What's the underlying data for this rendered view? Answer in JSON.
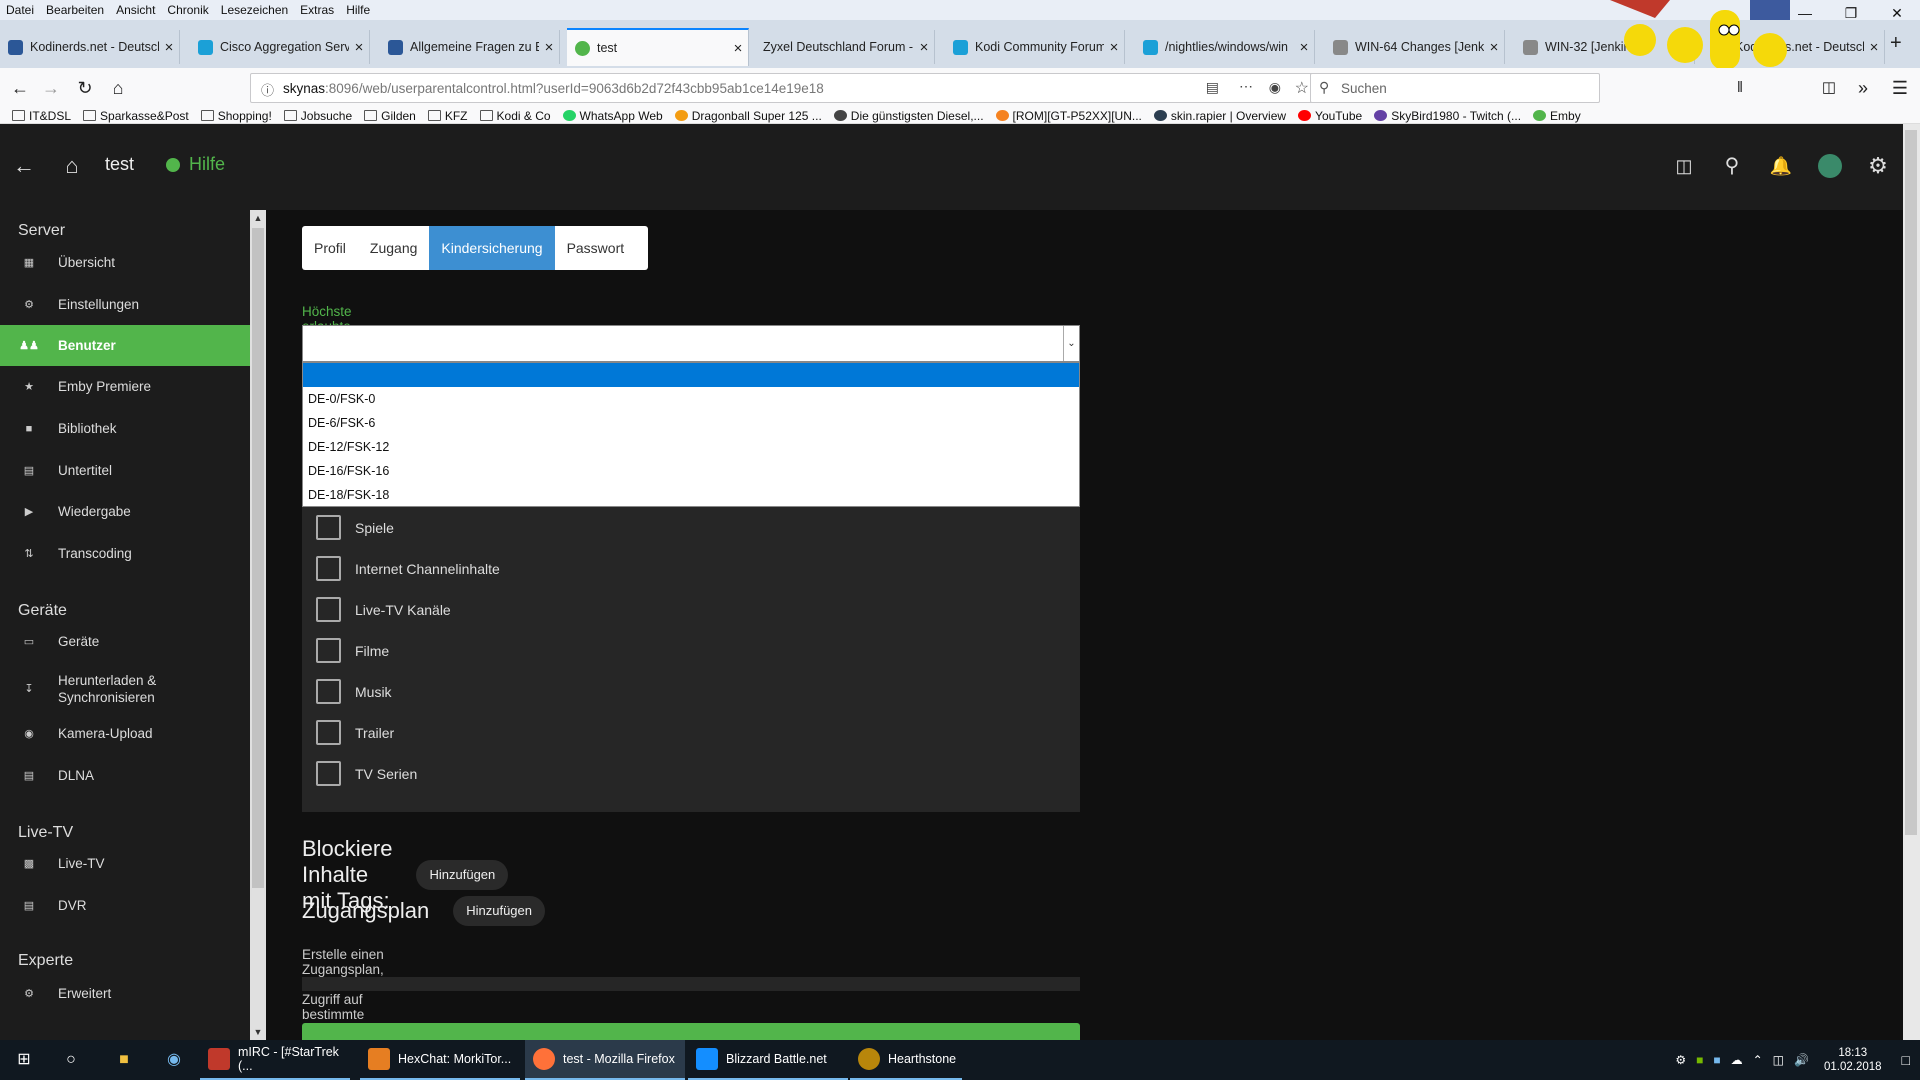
{
  "browser": {
    "menu": [
      "Datei",
      "Bearbeiten",
      "Ansicht",
      "Chronik",
      "Lesezeichen",
      "Extras",
      "Hilfe"
    ],
    "tabs": [
      {
        "label": "Kodinerds.net - Deutsch",
        "color": "#2b5797"
      },
      {
        "label": "Cisco Aggregation Servi",
        "color": "#1ba0d7"
      },
      {
        "label": "Allgemeine Fragen zu E",
        "color": "#2b5797"
      },
      {
        "label": "test",
        "color": "#52b54b"
      },
      {
        "label": "Zyxel Deutschland Forum - ",
        "color": "#ffffff"
      },
      {
        "label": "Kodi Community Forum",
        "color": "#1ba0d7"
      },
      {
        "label": "/nightlies/windows/win",
        "color": "#1ba0d7"
      },
      {
        "label": "WIN-64 Changes [Jenkin",
        "color": "#888888"
      },
      {
        "label": "WIN-32 [Jenkins]",
        "color": "#888888"
      },
      {
        "label": "Kodinerds.net - Deutsch",
        "color": "#2b5797"
      }
    ],
    "active_tab_index": 3,
    "url_host": "skynas",
    "url_path": ":8096/web/userparentalcontrol.html?userId=9063d6b2d72f43cbb95ab1ce14e19e18",
    "search_placeholder": "Suchen",
    "bookmarks": [
      {
        "label": "IT&DSL",
        "type": "folder"
      },
      {
        "label": "Sparkasse&Post",
        "type": "folder"
      },
      {
        "label": "Shopping!",
        "type": "folder"
      },
      {
        "label": "Jobsuche",
        "type": "folder"
      },
      {
        "label": "Gilden",
        "type": "folder"
      },
      {
        "label": "KFZ",
        "type": "folder"
      },
      {
        "label": "Kodi & Co",
        "type": "folder"
      },
      {
        "label": "WhatsApp Web",
        "type": "site",
        "color": "#25d366"
      },
      {
        "label": "Dragonball Super 125 ...",
        "type": "site",
        "color": "#f39c12"
      },
      {
        "label": "Die günstigsten Diesel,...",
        "type": "site",
        "color": "#444444"
      },
      {
        "label": "[ROM][GT-P52XX][UN...",
        "type": "site",
        "color": "#f58220"
      },
      {
        "label": "skin.rapier | Overview",
        "type": "site",
        "color": "#2c3e50"
      },
      {
        "label": "YouTube",
        "type": "site",
        "color": "#ff0000"
      },
      {
        "label": "SkyBird1980 - Twitch (...",
        "type": "site",
        "color": "#6441a5"
      },
      {
        "label": "Emby",
        "type": "site",
        "color": "#52b54b"
      }
    ]
  },
  "header": {
    "title": "test",
    "help_label": "Hilfe"
  },
  "sidebar": {
    "sections": [
      {
        "title": "Server",
        "items": [
          {
            "label": "Übersicht",
            "icon": "dashboard-icon"
          },
          {
            "label": "Einstellungen",
            "icon": "gear-icon"
          },
          {
            "label": "Benutzer",
            "icon": "people-icon",
            "active": true
          },
          {
            "label": "Emby Premiere",
            "icon": "star-icon"
          },
          {
            "label": "Bibliothek",
            "icon": "folder-icon"
          },
          {
            "label": "Untertitel",
            "icon": "subtitles-icon"
          },
          {
            "label": "Wiedergabe",
            "icon": "play-circle-icon"
          },
          {
            "label": "Transcoding",
            "icon": "transcode-icon"
          }
        ]
      },
      {
        "title": "Geräte",
        "items": [
          {
            "label": "Geräte",
            "icon": "devices-icon"
          },
          {
            "label": "Herunterladen & Synchronisieren",
            "icon": "download-icon"
          },
          {
            "label": "Kamera-Upload",
            "icon": "camera-icon"
          },
          {
            "label": "DLNA",
            "icon": "dlna-icon"
          }
        ]
      },
      {
        "title": "Live-TV",
        "items": [
          {
            "label": "Live-TV",
            "icon": "tv-icon"
          },
          {
            "label": "DVR",
            "icon": "dvr-icon"
          }
        ]
      },
      {
        "title": "Experte",
        "items": [
          {
            "label": "Erweitert",
            "icon": "gear-icon"
          }
        ]
      }
    ]
  },
  "content": {
    "tabs": [
      "Profil",
      "Zugang",
      "Kindersicherung",
      "Passwort"
    ],
    "active_tab": "Kindersicherung",
    "rating_label": "Höchste erlaubte elterlich Bewertung:",
    "rating_selected": "",
    "rating_options": [
      "",
      "DE-0/FSK-0",
      "DE-6/FSK-6",
      "DE-12/FSK-12",
      "DE-16/FSK-16",
      "DE-18/FSK-18"
    ],
    "block_items": [
      "Spiele",
      "Internet Channelinhalte",
      "Live-TV Kanäle",
      "Filme",
      "Musik",
      "Trailer",
      "TV Serien"
    ],
    "block_tags_heading": "Blockiere Inhalte mit Tags:",
    "block_tags_add": "Hinzufügen",
    "schedule_heading": "Zugangsplan",
    "schedule_add": "Hinzufügen",
    "schedule_description": "Erstelle einen Zugangsplan, um den Zugriff auf bestimmte Zeiten zu limitieren."
  },
  "taskbar": {
    "apps": [
      {
        "label": "mIRC - [#StarTrek (...",
        "color": "#c0392b"
      },
      {
        "label": "HexChat: MorkiTor...",
        "color": "#e67e22"
      },
      {
        "label": "test - Mozilla Firefox",
        "color": "#ff7139",
        "active": true
      },
      {
        "label": "Blizzard Battle.net",
        "color": "#148eff"
      },
      {
        "label": "Hearthstone",
        "color": "#b8860b"
      }
    ],
    "time": "18:13",
    "date": "01.02.2018"
  },
  "colors": {
    "accent_green": "#52b54b",
    "tab_active_blue": "#3d8fd2",
    "sidebar_bg": "#1c1c1c",
    "page_bg": "#101010"
  }
}
